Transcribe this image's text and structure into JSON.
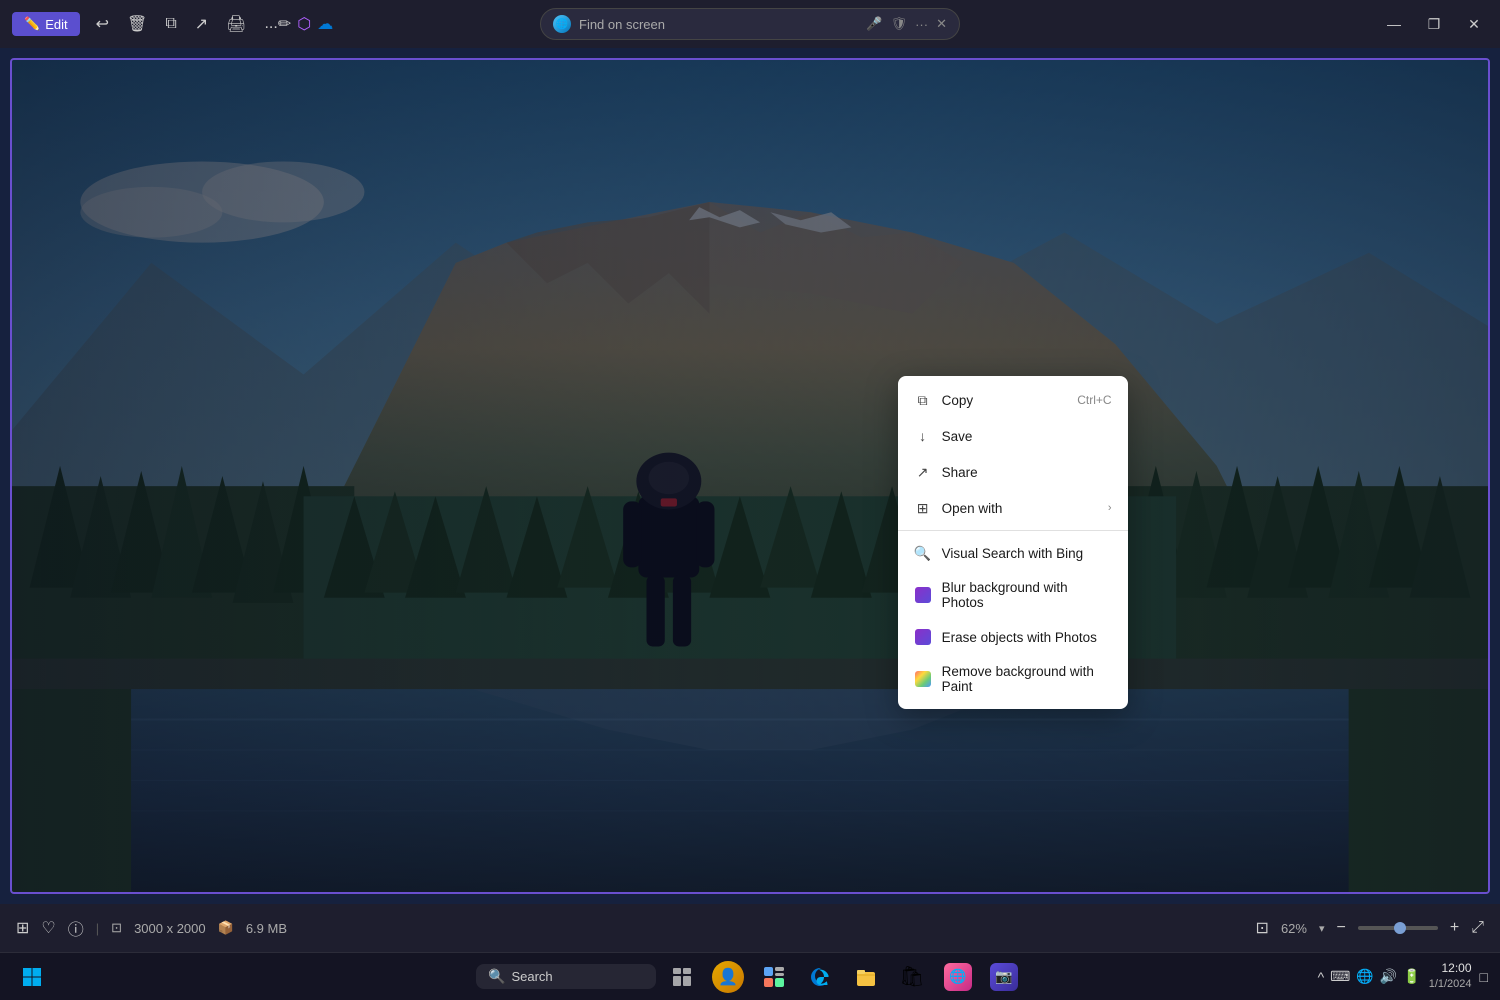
{
  "titlebar": {
    "edit_label": "Edit",
    "search_placeholder": "Find on screen",
    "more_label": "...",
    "close_label": "✕",
    "minimize_label": "—",
    "restore_label": "❐"
  },
  "photo": {
    "dimensions": "3000 × 2000",
    "file_size": "6.9 MB",
    "zoom_level": "62%"
  },
  "context_menu": {
    "items": [
      {
        "id": "copy",
        "label": "Copy",
        "shortcut": "Ctrl+C",
        "icon": "copy"
      },
      {
        "id": "save",
        "label": "Save",
        "shortcut": "",
        "icon": "save"
      },
      {
        "id": "share",
        "label": "Share",
        "shortcut": "",
        "icon": "share"
      },
      {
        "id": "open-with",
        "label": "Open with",
        "shortcut": "",
        "icon": "open",
        "has_arrow": true
      },
      {
        "id": "visual-search",
        "label": "Visual Search with Bing",
        "shortcut": "",
        "icon": "bing"
      },
      {
        "id": "blur-bg",
        "label": "Blur background with Photos",
        "shortcut": "",
        "icon": "photos"
      },
      {
        "id": "erase-objects",
        "label": "Erase objects with Photos",
        "shortcut": "",
        "icon": "photos2"
      },
      {
        "id": "remove-bg",
        "label": "Remove background with Paint",
        "shortcut": "",
        "icon": "paint"
      }
    ]
  },
  "taskbar": {
    "search_label": "Search",
    "search_placeholder": "Search",
    "time": "12:00",
    "date": "1/1/2024"
  },
  "status": {
    "dimensions_label": "3000 x 2000",
    "size_label": "6.9 MB",
    "zoom_label": "62%"
  }
}
